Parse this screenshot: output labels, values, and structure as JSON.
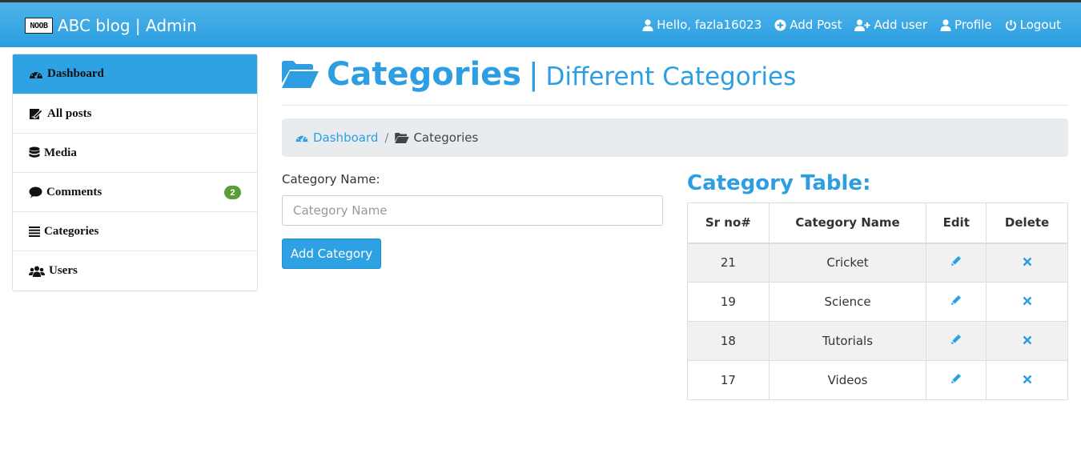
{
  "header": {
    "logo_text": "NOOB",
    "brand": "ABC blog | Admin",
    "nav": [
      {
        "label": "Hello, fazla16023",
        "icon": "user-icon"
      },
      {
        "label": "Add Post",
        "icon": "plus-circle-icon"
      },
      {
        "label": "Add user",
        "icon": "user-plus-icon"
      },
      {
        "label": "Profile",
        "icon": "user-icon"
      },
      {
        "label": "Logout",
        "icon": "power-icon"
      }
    ]
  },
  "sidebar": {
    "items": [
      {
        "label": "Dashboard",
        "icon": "dashboard-icon",
        "active": true
      },
      {
        "label": "All posts",
        "icon": "edit-icon"
      },
      {
        "label": "Media",
        "icon": "database-icon"
      },
      {
        "label": "Comments",
        "icon": "comment-icon",
        "badge": "2"
      },
      {
        "label": "Categories",
        "icon": "list-icon"
      },
      {
        "label": "Users",
        "icon": "users-icon"
      }
    ]
  },
  "page": {
    "title": "Categories",
    "separator": "|",
    "subtitle": "Different Categories"
  },
  "breadcrumb": {
    "items": [
      {
        "label": "Dashboard",
        "icon": "dashboard-icon"
      },
      {
        "label": "Categories",
        "icon": "folder-open-icon"
      }
    ],
    "separator": "/"
  },
  "form": {
    "label": "Category Name:",
    "placeholder": "Category Name",
    "value": "",
    "button_label": "Add Category"
  },
  "table": {
    "title": "Category Table:",
    "columns": [
      "Sr no#",
      "Category Name",
      "Edit",
      "Delete"
    ],
    "rows": [
      {
        "sr": "21",
        "name": "Cricket"
      },
      {
        "sr": "19",
        "name": "Science"
      },
      {
        "sr": "18",
        "name": "Tutorials"
      },
      {
        "sr": "17",
        "name": "Videos"
      }
    ]
  },
  "colors": {
    "header_bg": "#2a9ee0",
    "accent": "#2d9ee2",
    "badge": "#5a9e3a",
    "breadcrumb_bg": "#e9ecef"
  }
}
